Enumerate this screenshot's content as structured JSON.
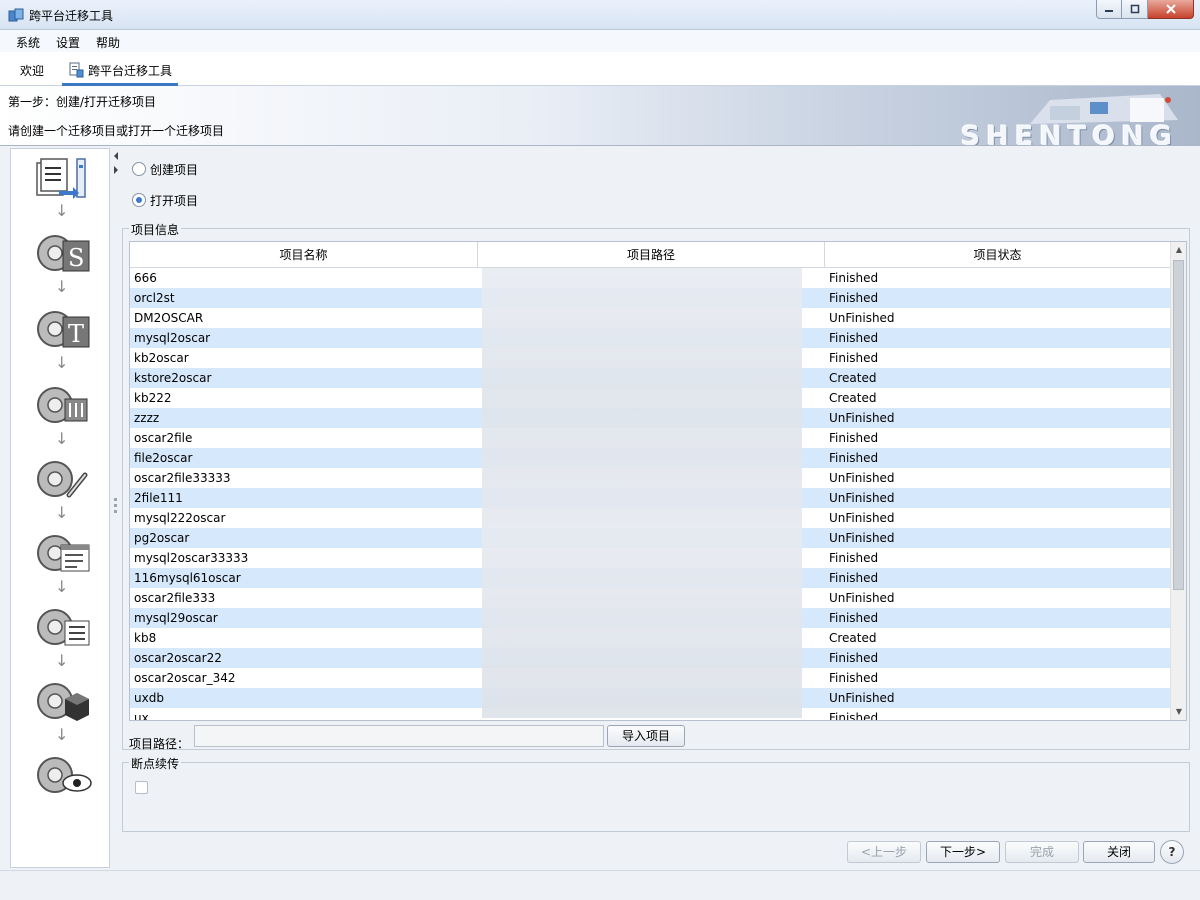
{
  "window": {
    "title": "跨平台迁移工具"
  },
  "menu": [
    {
      "label": "系统"
    },
    {
      "label": "设置"
    },
    {
      "label": "帮助"
    }
  ],
  "tabs": [
    {
      "label": "欢迎",
      "active": false
    },
    {
      "label": "跨平台迁移工具",
      "active": true
    }
  ],
  "banner": {
    "step_title": "第一步：创建/打开迁移项目",
    "step_desc": "请创建一个迁移项目或打开一个迁移项目",
    "brand": "SHENTONG"
  },
  "options": {
    "create_label": "创建项目",
    "open_label": "打开项目",
    "selected": "open"
  },
  "project_info": {
    "legend": "项目信息",
    "columns": [
      "项目名称",
      "项目路径",
      "项目状态"
    ],
    "rows": [
      {
        "name": "666",
        "status": "Finished"
      },
      {
        "name": "orcl2st",
        "status": "Finished"
      },
      {
        "name": "DM2OSCAR",
        "status": "UnFinished"
      },
      {
        "name": "mysql2oscar",
        "status": "Finished"
      },
      {
        "name": "kb2oscar",
        "status": "Finished"
      },
      {
        "name": "kstore2oscar",
        "status": "Created"
      },
      {
        "name": "kb222",
        "status": "Created"
      },
      {
        "name": "zzzz",
        "status": "UnFinished"
      },
      {
        "name": "oscar2file",
        "status": "Finished"
      },
      {
        "name": "file2oscar",
        "status": "Finished"
      },
      {
        "name": "oscar2file33333",
        "status": "UnFinished"
      },
      {
        "name": "2file111",
        "status": "UnFinished"
      },
      {
        "name": "mysql222oscar",
        "status": "UnFinished"
      },
      {
        "name": "pg2oscar",
        "status": "UnFinished"
      },
      {
        "name": "mysql2oscar33333",
        "status": "Finished"
      },
      {
        "name": "116mysql61oscar",
        "status": "Finished"
      },
      {
        "name": "oscar2file333",
        "status": "UnFinished"
      },
      {
        "name": "mysql29oscar",
        "status": "Finished"
      },
      {
        "name": "kb8",
        "status": "Created"
      },
      {
        "name": "oscar2oscar22",
        "status": "Finished"
      },
      {
        "name": "oscar2oscar_342",
        "status": "Finished"
      },
      {
        "name": "uxdb",
        "status": "UnFinished"
      },
      {
        "name": "ux",
        "status": "Finished"
      }
    ]
  },
  "path": {
    "label": "项目路径：",
    "value": "",
    "import_button": "导入项目"
  },
  "resume": {
    "legend": "断点续传"
  },
  "footer": {
    "prev": "<上一步",
    "next": "下一步>",
    "finish": "完成",
    "close": "关闭",
    "help": "?"
  },
  "colors": {
    "accent": "#3a78c4",
    "row_alt": "#d6e8fb"
  }
}
